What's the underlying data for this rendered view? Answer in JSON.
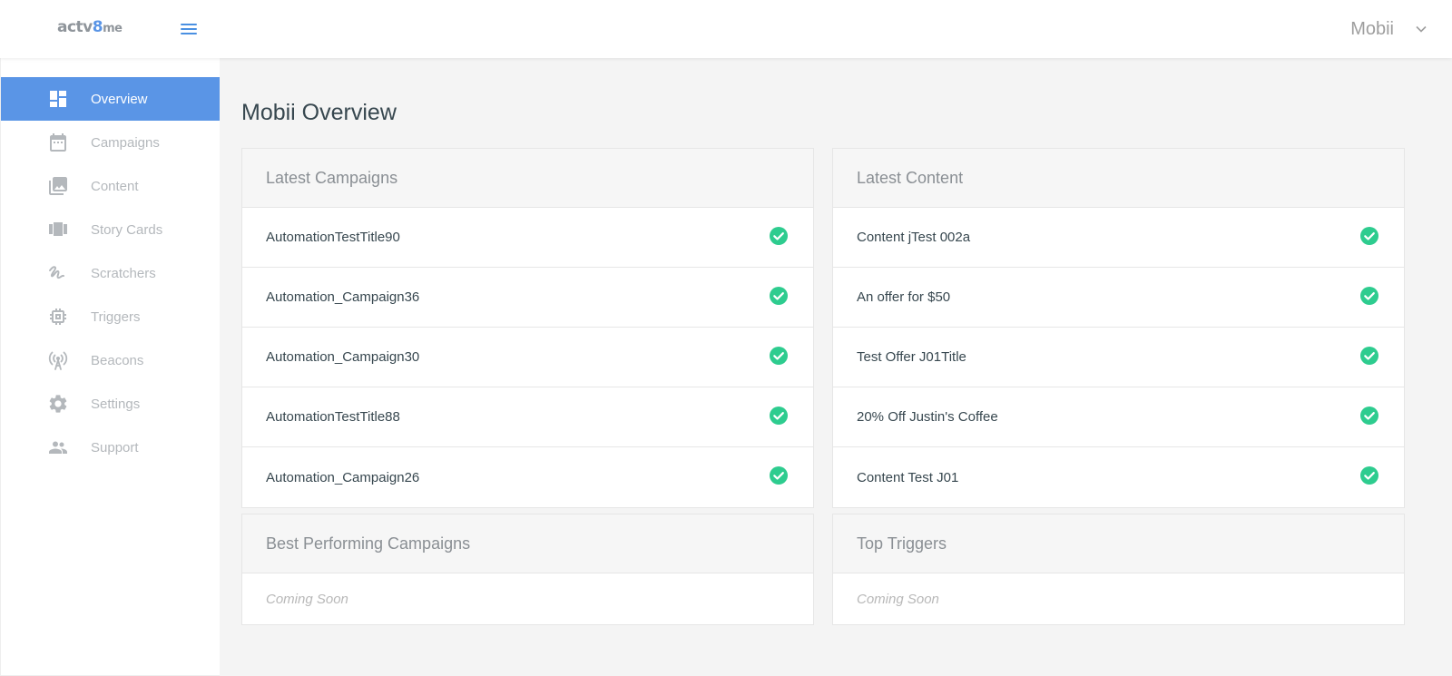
{
  "header": {
    "logo": {
      "part1": "actv",
      "part2": "8",
      "part3": "me"
    },
    "account_name": "Mobii",
    "icons": {
      "menu": "hamburger-icon",
      "account_toggle": "chevron-down-icon"
    }
  },
  "sidebar": {
    "items": [
      {
        "label": "Overview",
        "icon": "dashboard-icon",
        "active": true
      },
      {
        "label": "Campaigns",
        "icon": "calendar-icon",
        "active": false
      },
      {
        "label": "Content",
        "icon": "photo-library-icon",
        "active": false
      },
      {
        "label": "Story Cards",
        "icon": "carousel-icon",
        "active": false
      },
      {
        "label": "Scratchers",
        "icon": "gesture-icon",
        "active": false
      },
      {
        "label": "Triggers",
        "icon": "chip-icon",
        "active": false
      },
      {
        "label": "Beacons",
        "icon": "broadcast-tower-icon",
        "active": false
      },
      {
        "label": "Settings",
        "icon": "gear-icon",
        "active": false
      },
      {
        "label": "Support",
        "icon": "people-icon",
        "active": false
      }
    ]
  },
  "main": {
    "title": "Mobii Overview",
    "latest_campaigns": {
      "title": "Latest Campaigns",
      "items": [
        "AutomationTestTitle90",
        "Automation_Campaign36",
        "Automation_Campaign30",
        "AutomationTestTitle88",
        "Automation_Campaign26"
      ]
    },
    "latest_content": {
      "title": "Latest Content",
      "items": [
        "Content jTest 002a",
        "An offer for $50",
        "Test Offer J01Title",
        "20% Off Justin's Coffee",
        "Content Test J01"
      ]
    },
    "best_performing": {
      "title": "Best Performing Campaigns",
      "placeholder": "Coming Soon"
    },
    "top_triggers": {
      "title": "Top Triggers",
      "placeholder": "Coming Soon"
    }
  },
  "colors": {
    "accent": "#5a95e6",
    "status_ok": "#2ecc8f",
    "sidebar_text": "#b4b8bc",
    "background": "#f4f4f4"
  }
}
